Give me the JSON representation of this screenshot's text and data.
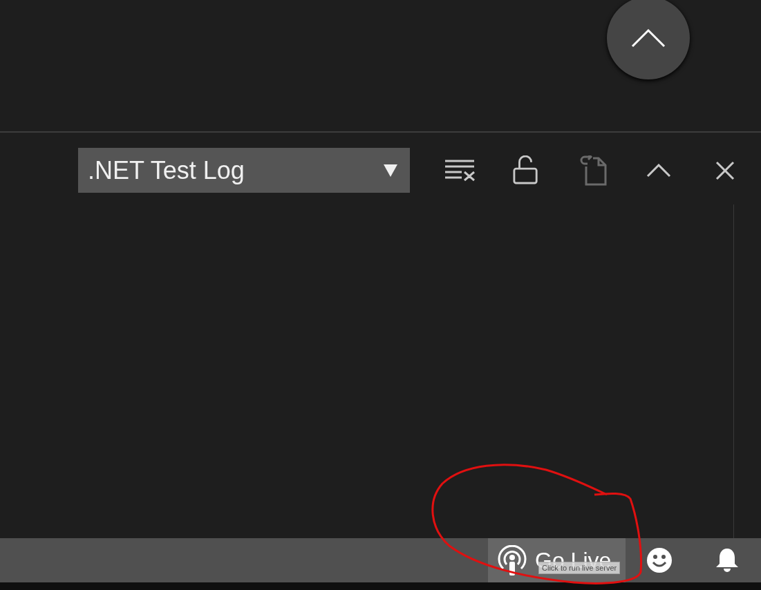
{
  "panel": {
    "output_selector": {
      "value": ".NET Test Log"
    },
    "toolbar": [
      {
        "kind": "clear",
        "disabled": false
      },
      {
        "kind": "lock",
        "disabled": false
      },
      {
        "kind": "open-file",
        "disabled": true
      },
      {
        "kind": "maximize",
        "disabled": false
      },
      {
        "kind": "close",
        "disabled": false
      }
    ]
  },
  "status_bar": {
    "go_live": {
      "label": "Go Live",
      "hovered": true
    },
    "tooltip": "Click to run live server"
  }
}
